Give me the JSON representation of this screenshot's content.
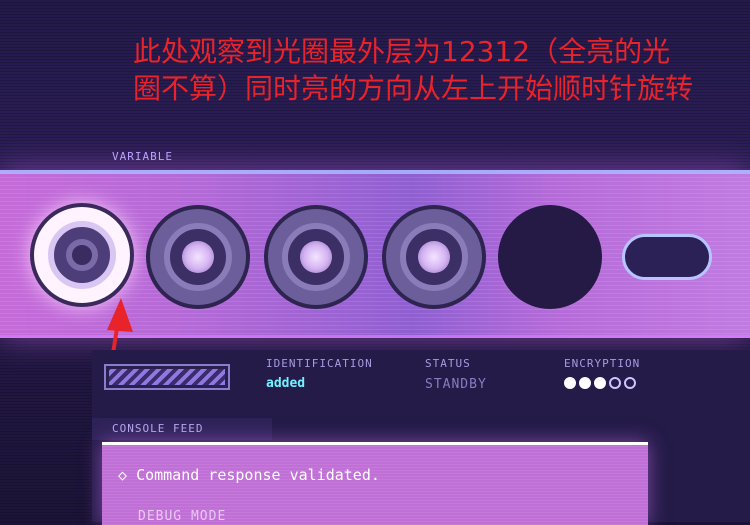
{
  "annotation": {
    "text": "此处观察到光圈最外层为12312（全亮的光圈不算）同时亮的方向从左上开始顺时针旋转",
    "color": "#e8232a"
  },
  "puzzle": {
    "variable_label": "VARIABLE",
    "rings": [
      {
        "state": "lit"
      },
      {
        "state": "dim"
      },
      {
        "state": "dim"
      },
      {
        "state": "dim"
      },
      {
        "state": "dark"
      }
    ],
    "toggle_slot": {
      "state": "empty"
    }
  },
  "info": {
    "identification_header": "IDENTIFICATION",
    "identification_value": "added",
    "status_header": "STATUS",
    "status_value": "STANDBY",
    "encryption_header": "ENCRYPTION",
    "encryption_dots": [
      true,
      true,
      true,
      false,
      false
    ]
  },
  "console": {
    "header": "CONSOLE FEED",
    "bullet": "◇",
    "line": "Command response validated.",
    "mode": "DEBUG MODE"
  },
  "colors": {
    "accent_cyan": "#6ff3ff",
    "standby": "#8a7cc0",
    "annotation_red": "#e8232a"
  },
  "icons": {
    "annotation_arrow": "arrow-up-icon",
    "bullet": "diamond-icon"
  }
}
